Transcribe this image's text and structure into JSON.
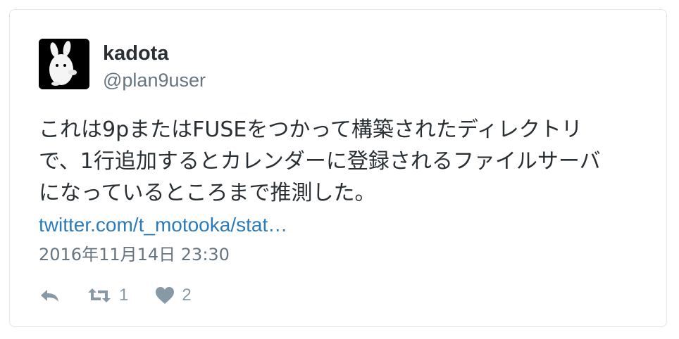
{
  "tweet": {
    "author_name": "kadota",
    "author_handle": "@plan9user",
    "text_lines": [
      "これは9pまたはFUSEをつかって構築されたディレクトリ",
      "で、1行追加するとカレンダーに登録されるファイルサーバ",
      "になっているところまで推測した。"
    ],
    "link_text": "twitter.com/t_motooka/stat…",
    "timestamp": "2016年11月14日 23:30",
    "retweet_count": "1",
    "like_count": "2"
  },
  "icons": {
    "reply": "reply-icon",
    "retweet": "retweet-icon",
    "like": "heart-icon"
  },
  "colors": {
    "text": "#292f33",
    "secondary": "#66757f",
    "link": "#2b7bb9",
    "icon": "#8899a6",
    "border": "#e1e8ed"
  }
}
